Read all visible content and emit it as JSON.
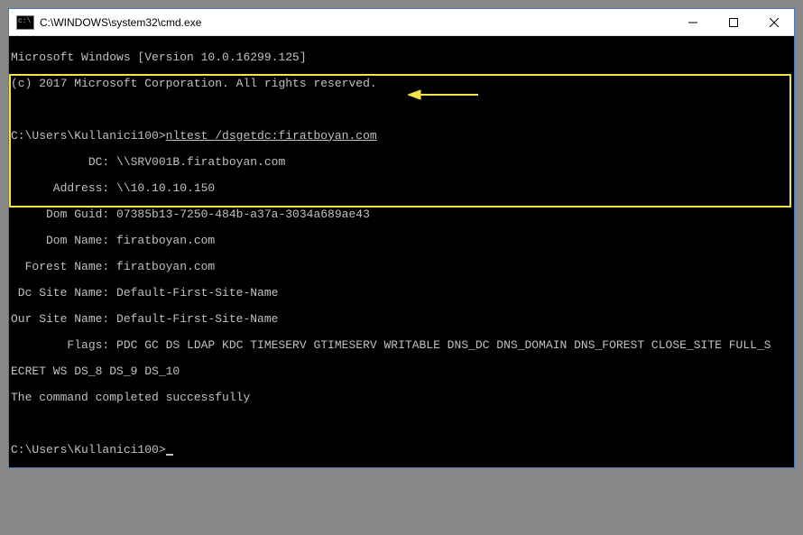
{
  "window": {
    "title": "C:\\WINDOWS\\system32\\cmd.exe"
  },
  "terminal": {
    "header_line1": "Microsoft Windows [Version 10.0.16299.125]",
    "header_line2": "(c) 2017 Microsoft Corporation. All rights reserved.",
    "prompt1_path": "C:\\Users\\Kullanici100>",
    "prompt1_command": "nltest /dsgetdc:firatboyan.com",
    "output": {
      "dc": "           DC: \\\\SRV001B.firatboyan.com",
      "address": "      Address: \\\\10.10.10.150",
      "dom_guid": "     Dom Guid: 07385b13-7250-484b-a37a-3034a689ae43",
      "dom_name": "     Dom Name: firatboyan.com",
      "forest_name": "  Forest Name: firatboyan.com",
      "dc_site_name": " Dc Site Name: Default-First-Site-Name",
      "our_site_name": "Our Site Name: Default-First-Site-Name",
      "flags": "        Flags: PDC GC DS LDAP KDC TIMESERV GTIMESERV WRITABLE DNS_DC DNS_DOMAIN DNS_FOREST CLOSE_SITE FULL_S",
      "flags_cont": "ECRET WS DS_8 DS_9 DS_10",
      "completed": "The command completed successfully"
    },
    "prompt2_path": "C:\\Users\\Kullanici100>"
  },
  "annotation": {
    "highlight_color": "#f5e342",
    "arrow_color": "#f5e342"
  }
}
